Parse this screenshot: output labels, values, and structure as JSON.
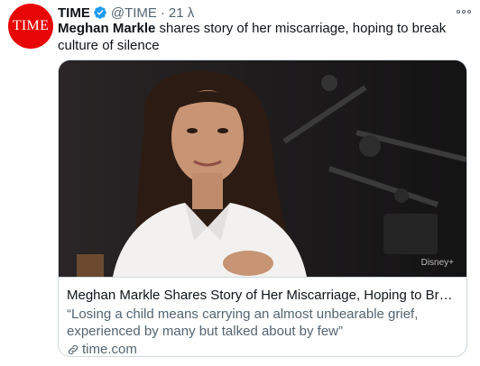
{
  "account": {
    "avatar_text": "TIME",
    "display_name": "TIME",
    "handle": "@TIME",
    "separator": "·",
    "timestamp": "21 λ",
    "brand_color": "#e90606",
    "verified_color": "#1d9bf0"
  },
  "tweet": {
    "bold_text": "Meghan Markle",
    "text": " shares story of her miscarriage, hoping to break culture of silence"
  },
  "card": {
    "image_icon": "interview-photo",
    "watermark": "Disney+",
    "title": "Meghan Markle Shares Story of Her Miscarriage, Hoping to Break Culture of Silence",
    "description": "“Losing a child means carrying an almost unbearable grief, experienced by many but talked about by few”",
    "domain": "time.com"
  },
  "icons": {
    "verified": "verified-badge-icon",
    "more": "more-options-icon",
    "link": "link-icon"
  }
}
